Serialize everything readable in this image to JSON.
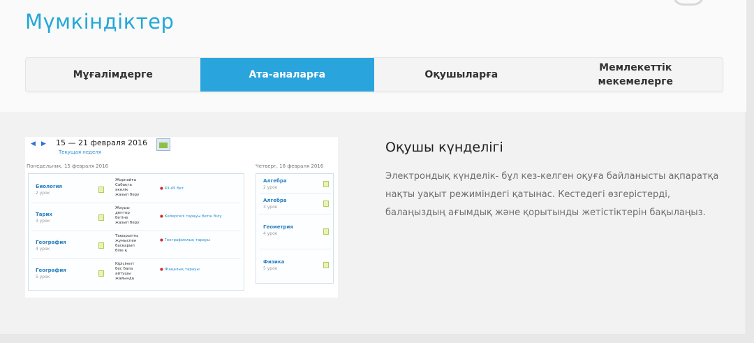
{
  "page": {
    "title": "Мүмкіндіктер"
  },
  "tabs": [
    {
      "label": "Мұғалімдерге",
      "active": false
    },
    {
      "label": "Ата-аналарға",
      "active": true
    },
    {
      "label": "Оқушыларға",
      "active": false
    },
    {
      "label": "Мемлекеттік\nмекемелерге",
      "active": false
    }
  ],
  "colors": {
    "accent": "#2aa4dc",
    "title": "#22a7d8"
  },
  "preview": {
    "prev_icon": "arrow-left-icon",
    "next_icon": "arrow-right-icon",
    "calendar_icon": "calendar-icon",
    "week_range": "15 — 21 февраля 2016",
    "week_sub": "Текущая неделя",
    "day1": {
      "label": "Понедельник, 15 февраля 2016",
      "lessons": [
        {
          "subject": "Биология",
          "num": "2 урок",
          "hw": "Жорнайға\nСабақта\nәкелік\nжазып беру",
          "mark": "43-45 бет"
        },
        {
          "subject": "Тарих",
          "num": "3 урок",
          "hw": "Жауды\nдептер\nбетіне\nжазып беру",
          "mark": "Келергелі тарауы бетін білу"
        },
        {
          "subject": "География",
          "num": "4 урок",
          "hw": "Тақырыпты\nжұмыспен\nбасқарып\nбіле қ",
          "mark": "Географиялық тарауы"
        },
        {
          "subject": "География",
          "num": "5 урок",
          "hw": "Кірісінеті\nбес бала\nайтушы\nжайында",
          "mark": "Жаңалық тарауы"
        }
      ]
    },
    "day2": {
      "label": "Четверг, 18 февраля 2016",
      "lessons": [
        {
          "subject": "Алгебра",
          "num": "2 урок"
        },
        {
          "subject": "Алгебра",
          "num": "3 урок"
        },
        {
          "subject": "Геометрия",
          "num": "4 урок"
        },
        {
          "subject": "Физика",
          "num": "5 урок"
        }
      ]
    }
  },
  "feature": {
    "title": "Оқушы күнделігі",
    "description": "Электрондық күнделік- бұл кез-келген оқуға байланысты ақпаратқа нақты уақыт режиміндегі қатынас. Кестедегі өзгерістерді, балаңыздың ағымдық және қорытынды жетістіктерін бақылаңыз."
  }
}
